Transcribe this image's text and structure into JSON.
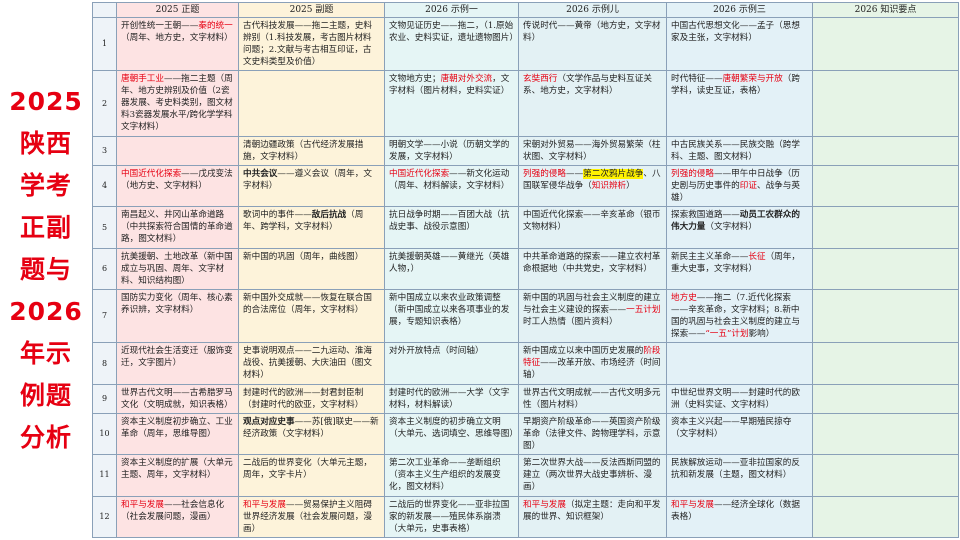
{
  "side_title": [
    "2025",
    "陕西",
    "学考",
    "正副",
    "题与",
    "2026",
    "年示",
    "例题",
    "分析"
  ],
  "colors": {
    "title_red": "#e60012",
    "highlight_yellow": "#fff200",
    "col_main": "#fde3e3",
    "col_vice": "#fdf3da",
    "col_ex1": "#e5f5f5",
    "col_ex2": "#e3f1f4",
    "col_ex3": "#e3f1f7",
    "col_kp": "#e6f4e6"
  },
  "headers": [
    "",
    "2025 正题",
    "2025 副题",
    "2026 示例一",
    "2026 示例儿",
    "2026 示例三",
    "2026 知识要点"
  ],
  "rows": [
    {
      "num": "1",
      "main": [
        {
          "t": "开创性统一王朝——"
        },
        {
          "t": "秦的统一",
          "c": "red"
        },
        {
          "t": "（周年、地方史，文字材料）"
        }
      ],
      "vice": [
        {
          "t": "古代科技发展——拖二主题，史料辨别（1.科技发展，考古图片材料问题；2.文献与考古相互印证，古文史料类型及价值）"
        }
      ],
      "ex1": [
        {
          "t": "文物见证历史——拖二，（1.原始农业、史料实证，遗址遗物图片）"
        }
      ],
      "ex2": [
        {
          "t": "传说时代——黄帝（地方史，文字材料）"
        }
      ],
      "ex3": [
        {
          "t": "中国古代思想文化——孟子（思想家及主张，文字材料）"
        }
      ]
    },
    {
      "num": "2",
      "main": [
        {
          "t": "唐朝手工业",
          "c": "red"
        },
        {
          "t": "——拖二主题（周年、地方史辨别及价值（2瓷器发展、考史料类别，图文材料3瓷器发展水平/跨化学学科文字材料）"
        }
      ],
      "vice": [],
      "ex1": [
        {
          "t": "文物地方史；"
        },
        {
          "t": "唐朝对外交流",
          "c": "red"
        },
        {
          "t": "，文字材料（图片材料，史料实证）"
        }
      ],
      "ex2": [
        {
          "t": "玄奘西行",
          "c": "red"
        },
        {
          "t": "（文学作品与史料互证关系、地方史，文字材料）"
        }
      ],
      "ex3": [
        {
          "t": "时代特征——"
        },
        {
          "t": "唐朝繁荣与开放",
          "c": "red"
        },
        {
          "t": "（跨学科，读史互证，表格）"
        }
      ]
    },
    {
      "num": "3",
      "main": [],
      "vice": [
        {
          "t": "清朝边疆政策（古代经济发展措施，文字材料）"
        }
      ],
      "ex1": [
        {
          "t": "明朝文学——小说（历朝文学的发展，文字材料）"
        }
      ],
      "ex2": [
        {
          "t": "宋朝对外贸易——海外贸易繁荣（柱状图、文字材料）"
        }
      ],
      "ex3": [
        {
          "t": "中古民族关系——民族交融（跨学科、主题、图文材料）"
        }
      ]
    },
    {
      "num": "4",
      "main": [
        {
          "t": "中国近代化探索",
          "c": "red"
        },
        {
          "t": "——戊戌变法（地方史、文字材料）"
        }
      ],
      "vice": [
        {
          "t": "中共会议",
          "c": "b"
        },
        {
          "t": "——遵义会议（周年，文字材料）"
        }
      ],
      "ex1": [
        {
          "t": "中国近代化探索",
          "c": "red"
        },
        {
          "t": "——新文化运动（周年、材料解读，文字材料）"
        }
      ],
      "ex2": [
        {
          "t": "列强的侵略",
          "c": "red"
        },
        {
          "t": "——"
        },
        {
          "t": "第二次鸦片战争",
          "c": "hl"
        },
        {
          "t": "、八国联军侵华战争（"
        },
        {
          "t": "知识辨析",
          "c": "red"
        },
        {
          "t": "）"
        }
      ],
      "ex3": [
        {
          "t": "列强的侵略",
          "c": "red"
        },
        {
          "t": "——甲午中日战争（历史剧与历史事件的"
        },
        {
          "t": "印证",
          "c": "red"
        },
        {
          "t": "、战争与英雄）"
        }
      ]
    },
    {
      "num": "5",
      "main": [
        {
          "t": "南昌起义、井冈山革命道路（中共探索符合国情的革命道路，图文材料）"
        }
      ],
      "vice": [
        {
          "t": "歌词中的事件——"
        },
        {
          "t": "敌后抗战",
          "c": "b"
        },
        {
          "t": "（周年、跨学科，文字材料）"
        }
      ],
      "ex1": [
        {
          "t": "抗日战争时期——百团大战（抗战史事、战役示意图）"
        }
      ],
      "ex2": [
        {
          "t": "中国近代化探索——辛亥革命（银币文物材料）"
        }
      ],
      "ex3": [
        {
          "t": "探索救国道路——"
        },
        {
          "t": "动员工农群众的伟大力量",
          "c": "b"
        },
        {
          "t": "（文字材料）"
        }
      ]
    },
    {
      "num": "6",
      "main": [
        {
          "t": "抗美援朝、土地改革（新中国成立与巩固、周年、文字材料、知识结构图）"
        }
      ],
      "vice": [
        {
          "t": "新中国的巩固（周年，曲线图）"
        }
      ],
      "ex1": [
        {
          "t": "抗美援朝英雄——黄继光（英雄人物，）"
        }
      ],
      "ex2": [
        {
          "t": "中共革命道路的探索——建立农村革命根据地（中共党史，文字材料）"
        }
      ],
      "ex3": [
        {
          "t": "新民主主义革命——"
        },
        {
          "t": "长征",
          "c": "red"
        },
        {
          "t": "（周年，重大史事，文字材料）"
        }
      ]
    },
    {
      "num": "7",
      "main": [
        {
          "t": "国防实力变化（周年、核心素养识辨，文字材料）"
        }
      ],
      "vice": [
        {
          "t": "新中国外交成就——恢复在联合国的合法席位（周年，文字材料）"
        }
      ],
      "ex1": [
        {
          "t": "新中国成立以来农业政策调整（新中国成立以来各项事业的发展，专题知识表格）"
        }
      ],
      "ex2": [
        {
          "t": "新中国的巩固与社会主义制度的建立与社会主义建设的探索——"
        },
        {
          "t": "一五计划",
          "c": "red"
        },
        {
          "t": "时工人热情（图片资料）"
        }
      ],
      "ex3": [
        {
          "t": "地方史",
          "c": "red"
        },
        {
          "t": "——拖二（7.近代化探索——辛亥革命，文字材料；8.新中国的巩固与社会主义制度的建立与探索——"
        },
        {
          "t": "“一五”计划",
          "c": "red"
        },
        {
          "t": "影响）"
        }
      ]
    },
    {
      "num": "8",
      "main": [
        {
          "t": "近现代社会生活变迁（服饰变迁，文字图片）"
        }
      ],
      "vice": [
        {
          "t": "史事说明观点——二九运动、淮海战役、抗美援朝、大庆油田（图文材料）"
        }
      ],
      "ex1": [
        {
          "t": "对外开放特点（时间轴）"
        }
      ],
      "ex2": [
        {
          "t": "新中国成立以来中国历史发展的"
        },
        {
          "t": "阶段特征",
          "c": "red"
        },
        {
          "t": "——改革开放、市场经济（时间轴）"
        }
      ],
      "ex3": []
    },
    {
      "num": "9",
      "main": [
        {
          "t": "世界古代文明——古希腊罗马文化（文明成就，知识表格）"
        }
      ],
      "vice": [
        {
          "t": "封建时代的欧洲——封君封臣制（封建时代的欧亚，文字材料）"
        }
      ],
      "ex1": [
        {
          "t": "封建时代的欧洲——大学（文字材料，材料解读）"
        }
      ],
      "ex2": [
        {
          "t": "世界古代文明成就——古代文明多元性（图片材料）"
        }
      ],
      "ex3": [
        {
          "t": "中世纪世界文明——封建时代的欧洲（史料实证、文字材料）"
        }
      ]
    },
    {
      "num": "10",
      "main": [
        {
          "t": "资本主义制度初步确立、工业革命（周年，思维导图）"
        }
      ],
      "vice": [
        {
          "t": "观点对应史事",
          "c": "b"
        },
        {
          "t": "——苏[俄]联史——新经济政策（文字材料）"
        }
      ],
      "ex1": [
        {
          "t": "资本主义制度的初步确立文明（大单元、选词填空、思维导图）"
        }
      ],
      "ex2": [
        {
          "t": "早期资产阶级革命——英国资产阶级革命（法律文件、跨物理学科，示意图）"
        }
      ],
      "ex3": [
        {
          "t": "资本主义兴起——早期殖民掠夺（文字材料）"
        }
      ]
    },
    {
      "num": "11",
      "main": [
        {
          "t": "资本主义制度的扩展（大单元主题、周年，文字材料）"
        }
      ],
      "vice": [
        {
          "t": "二战后的世界变化（大单元主题，周年，文字卡片）"
        }
      ],
      "ex1": [
        {
          "t": "第二次工业革命——垄断组织（资本主义生产组织的发展变化，图文材料）"
        }
      ],
      "ex2": [
        {
          "t": "第二次世界大战——反法西斯同盟的建立（两次世界大战史事辨析、漫画）"
        }
      ],
      "ex3": [
        {
          "t": "民族解放运动——亚非拉国家的反抗和新发展（主题，图文材料）"
        }
      ]
    },
    {
      "num": "12",
      "main": [
        {
          "t": "和平与发展",
          "c": "red"
        },
        {
          "t": "——社会信息化（社会发展问题，漫画）"
        }
      ],
      "vice": [
        {
          "t": "和平与发展",
          "c": "red"
        },
        {
          "t": "——贸易保护主义阻碍世界经济发展（社会发展问题，漫画）"
        }
      ],
      "ex1": [
        {
          "t": "二战后的世界变化——亚非拉国家的新发展——殖民体系崩溃（大单元，史事表格）"
        }
      ],
      "ex2": [
        {
          "t": "和平与发展",
          "c": "red"
        },
        {
          "t": "（拟定主题：走向和平发展的世界、知识框架）"
        }
      ],
      "ex3": [
        {
          "t": "和平与发展",
          "c": "red"
        },
        {
          "t": "——经济全球化（数据表格）"
        }
      ]
    }
  ]
}
